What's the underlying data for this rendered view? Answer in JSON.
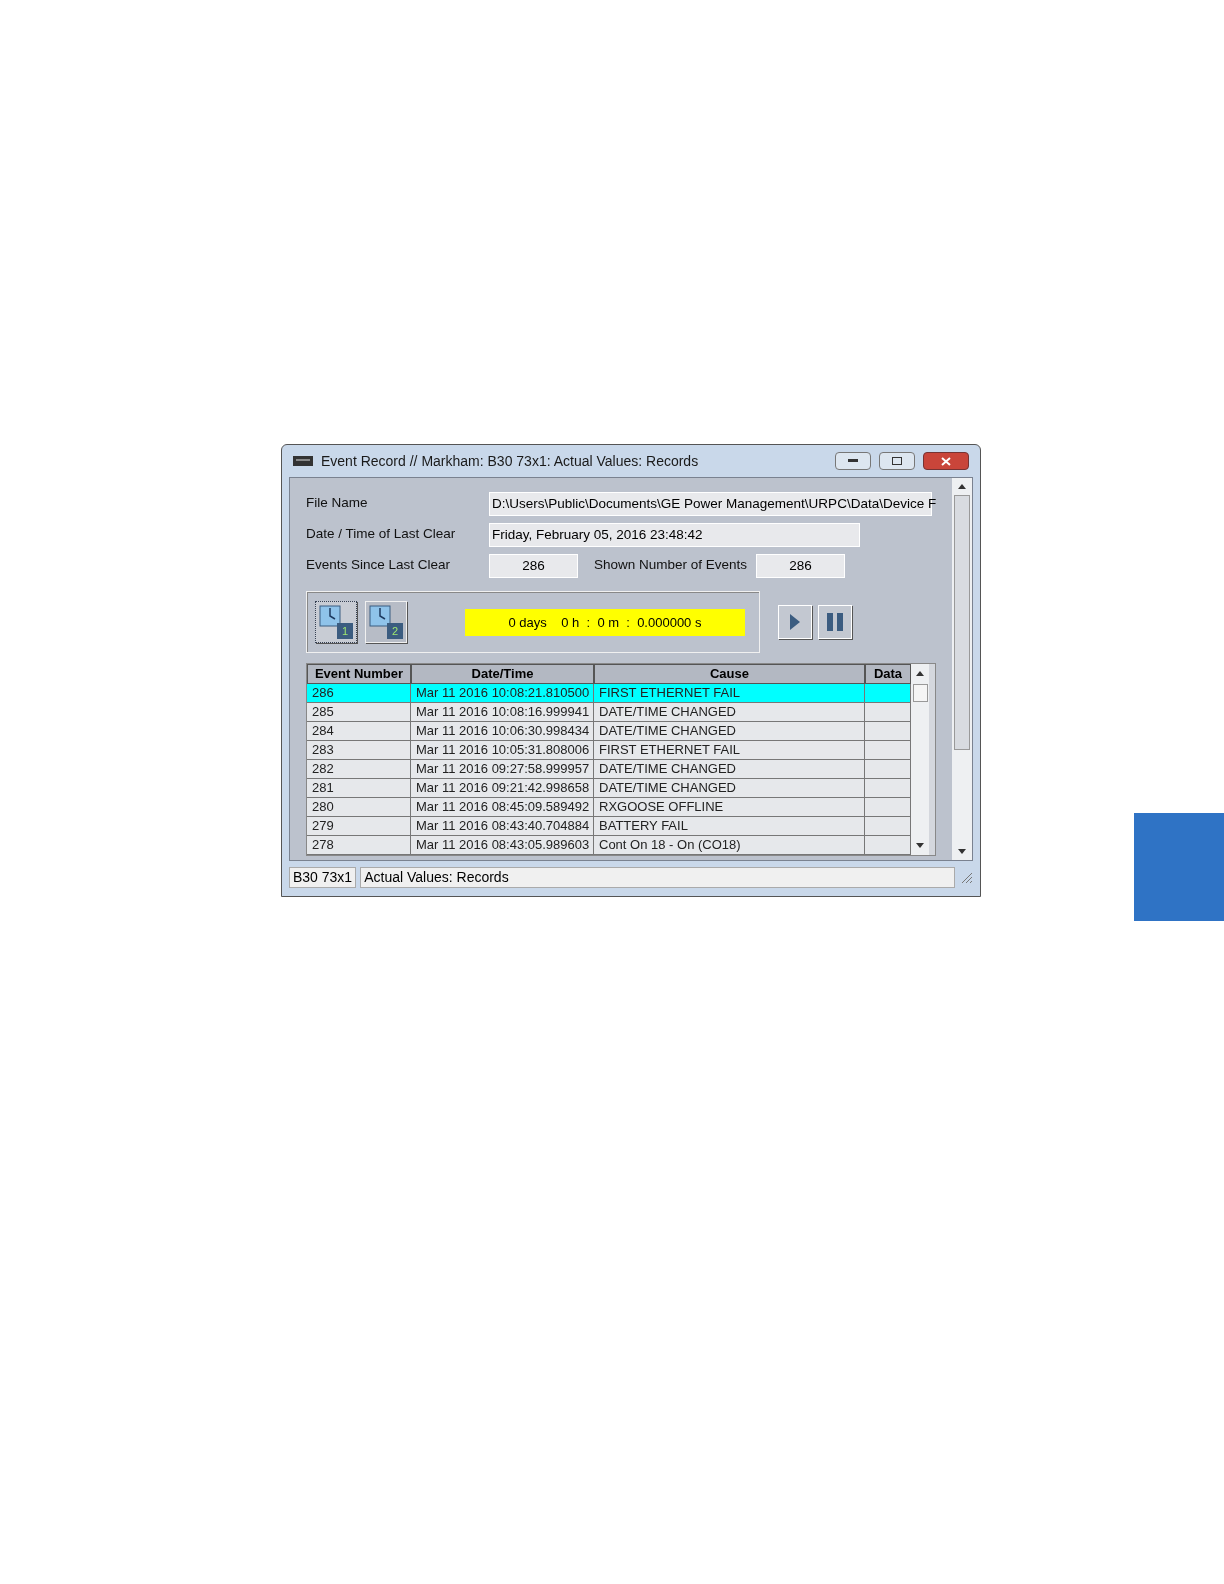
{
  "window": {
    "title": "Event Record // Markham: B30 73x1: Actual Values: Records"
  },
  "fields": [
    {
      "label": "File Name",
      "value": "D:\\Users\\Public\\Documents\\GE Power Management\\URPC\\Data\\Device F"
    },
    {
      "label": "Date / Time of Last Clear",
      "value": "Friday, February 05, 2016 23:48:42"
    }
  ],
  "counts": [
    {
      "label": "Events Since Last Clear",
      "value": "286"
    },
    {
      "label": "Shown Number of Events",
      "value": "286"
    }
  ],
  "trigger_buttons": [
    {
      "number": "1",
      "selected": true
    },
    {
      "number": "2",
      "selected": false
    }
  ],
  "timer": "0 days    0 h  :  0 m  :  0.000000 s",
  "table": {
    "columns": [
      "Event Number",
      "Date/Time",
      "Cause",
      "Data"
    ],
    "rows": [
      {
        "cells": [
          "286",
          "Mar 11 2016 10:08:21.810500",
          "FIRST ETHERNET FAIL",
          ""
        ],
        "selected": true
      },
      {
        "cells": [
          "285",
          "Mar 11 2016 10:08:16.999941",
          "DATE/TIME CHANGED",
          ""
        ],
        "selected": false
      },
      {
        "cells": [
          "284",
          "Mar 11 2016 10:06:30.998434",
          "DATE/TIME CHANGED",
          ""
        ],
        "selected": false
      },
      {
        "cells": [
          "283",
          "Mar 11 2016 10:05:31.808006",
          "FIRST ETHERNET FAIL",
          ""
        ],
        "selected": false
      },
      {
        "cells": [
          "282",
          "Mar 11 2016 09:27:58.999957",
          "DATE/TIME CHANGED",
          ""
        ],
        "selected": false
      },
      {
        "cells": [
          "281",
          "Mar 11 2016 09:21:42.998658",
          "DATE/TIME CHANGED",
          ""
        ],
        "selected": false
      },
      {
        "cells": [
          "280",
          "Mar 11 2016 08:45:09.589492",
          "RXGOOSE OFFLINE",
          ""
        ],
        "selected": false
      },
      {
        "cells": [
          "279",
          "Mar 11 2016 08:43:40.704884",
          "BATTERY FAIL",
          ""
        ],
        "selected": false
      },
      {
        "cells": [
          "278",
          "Mar 11 2016 08:43:05.989603",
          "Cont On 18 - On (CO18)",
          ""
        ],
        "selected": false
      }
    ]
  },
  "status_bar": [
    "B30 73x1",
    "Actual Values: Records"
  ]
}
